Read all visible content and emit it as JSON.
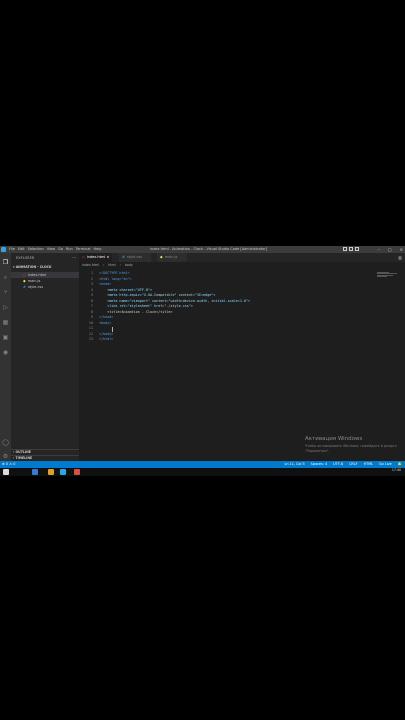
{
  "window": {
    "menu": [
      "File",
      "Edit",
      "Selection",
      "View",
      "Go",
      "Run",
      "Terminal",
      "Help"
    ],
    "title": "index.html - Animation - Clock - Visual Studio Code [Administrator]"
  },
  "sidebar": {
    "header": "EXPLORER",
    "section": "ANIMATION - CLOCK",
    "files": [
      {
        "name": "index.html",
        "icon": "html-file-icon"
      },
      {
        "name": "main.js",
        "icon": "js-file-icon"
      },
      {
        "name": "style.css",
        "icon": "css-file-icon"
      }
    ],
    "outline": "OUTLINE",
    "timeline": "TIMELINE"
  },
  "tabs": [
    {
      "label": "index.html",
      "active": true
    },
    {
      "label": "style.css",
      "active": false
    },
    {
      "label": "main.js",
      "active": false
    }
  ],
  "breadcrumb": [
    "index.html",
    "html",
    "body"
  ],
  "code": [
    {
      "n": "1",
      "text": "<!DOCTYPE html>"
    },
    {
      "n": "2",
      "text": "<html lang=\"en\">"
    },
    {
      "n": "3",
      "text": "<head>"
    },
    {
      "n": "4",
      "text": "    <meta charset=\"UTF-8\">"
    },
    {
      "n": "5",
      "text": "    <meta http-equiv=\"X-UA-Compatible\" content=\"IE=edge\">"
    },
    {
      "n": "6",
      "text": "    <meta name=\"viewport\" content=\"width=device-width, initial-scale=1.0\">"
    },
    {
      "n": "7",
      "text": "    <link rel=\"stylesheet\" href=\"./style.css\">"
    },
    {
      "n": "8",
      "text": "    <title>Animation - Clock</title>"
    },
    {
      "n": "9",
      "text": "</head>"
    },
    {
      "n": "10",
      "text": "<body>"
    },
    {
      "n": "11",
      "text": "    "
    },
    {
      "n": "12",
      "text": "</body>"
    },
    {
      "n": "13",
      "text": "</html>"
    }
  ],
  "activation": {
    "title": "Активация Windows",
    "text": "Чтобы активировать Windows, перейдите в раздел \"Параметры\"."
  },
  "status": {
    "left": "⊗ 0 ⚠ 0",
    "position": "Ln 11, Col 5",
    "spaces": "Spaces: 4",
    "encoding": "UTF-8",
    "eol": "CRLF",
    "language": "HTML",
    "golive": "Go Live"
  },
  "taskbar": {
    "time": "17:40"
  },
  "colors": {
    "accent": "#007acc",
    "tag": "#569cd6",
    "attr": "#9cdcfe",
    "string": "#ce9178"
  }
}
